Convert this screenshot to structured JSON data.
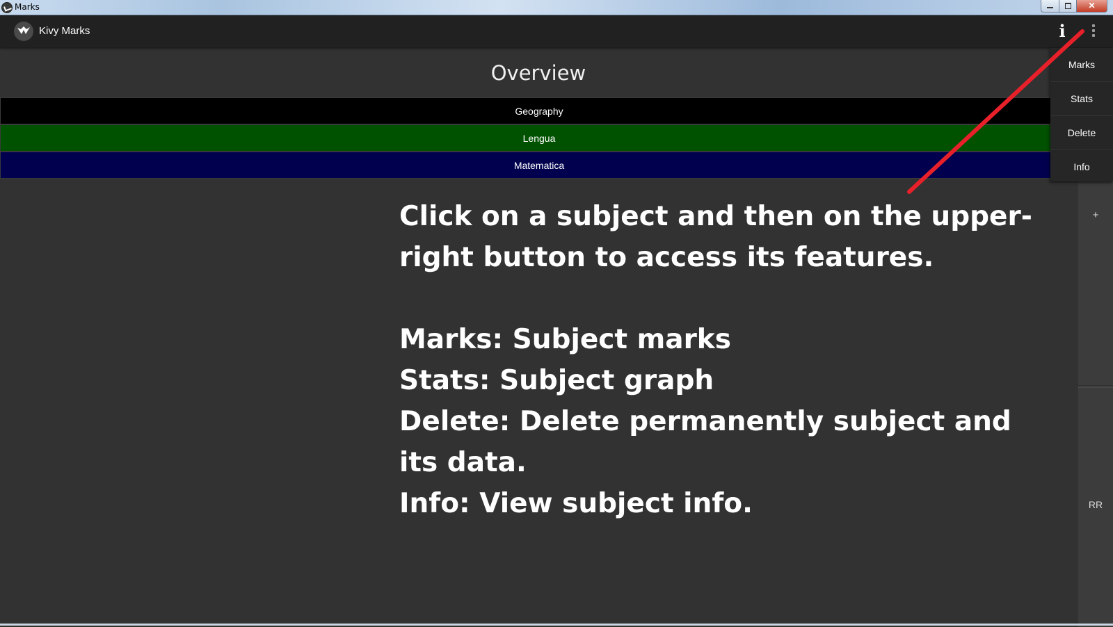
{
  "window": {
    "title": "Marks"
  },
  "app_bar": {
    "title": "Kivy Marks",
    "info_icon": "i"
  },
  "overview": {
    "title": "Overview"
  },
  "subjects": [
    {
      "label": "Geography",
      "color": "#000000"
    },
    {
      "label": "Lengua",
      "color": "#005100"
    },
    {
      "label": "Matematica",
      "color": "#00004f"
    }
  ],
  "menu": {
    "items": [
      "Marks",
      "Stats",
      "Delete",
      "Info"
    ]
  },
  "side_panel": {
    "plus_label": "+",
    "rr_label": "RR"
  },
  "help": {
    "intro": "Click on a subject and then on the upper-right button to access its features.",
    "lines": [
      "Marks: Subject marks",
      "Stats: Subject graph",
      "Delete: Delete permanently subject and its data.",
      "Info: View subject info."
    ]
  },
  "colors": {
    "background": "#323232",
    "app_bar": "#212121",
    "annotation": "#e8202a"
  }
}
